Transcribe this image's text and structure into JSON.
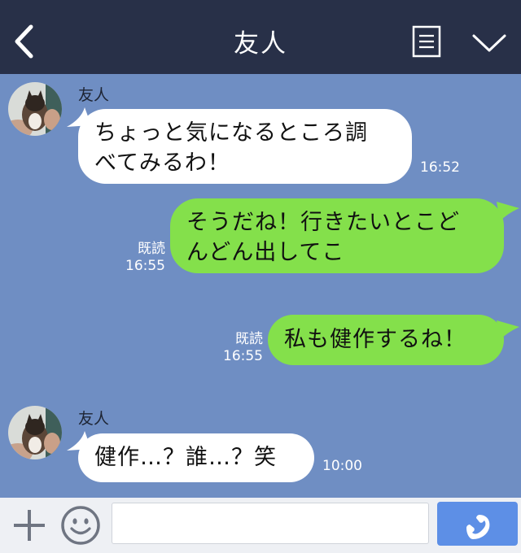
{
  "header": {
    "title": "友人",
    "icons": {
      "back": "chevron-left-icon",
      "memo": "note-icon",
      "menu": "chevron-down-icon"
    }
  },
  "messages": [
    {
      "side": "left",
      "sender": "友人",
      "lines": [
        "ちょっと気になるところ調",
        "べてみるわ！"
      ],
      "time": "16:52"
    },
    {
      "side": "right",
      "read": "既読",
      "lines": [
        "そうだね！行きたいとこど",
        "んどん出してこ"
      ],
      "time": "16:55"
    },
    {
      "side": "right",
      "read": "既読",
      "lines": [
        "私も健作するね！"
      ],
      "time": "16:55"
    },
    {
      "side": "left",
      "sender": "友人",
      "lines": [
        "健作…？誰…？笑"
      ],
      "time": "10:00"
    }
  ],
  "footer": {
    "input_value": "",
    "icons": {
      "plus": "plus-icon",
      "emoji": "smiley-icon",
      "call": "phone-icon"
    }
  },
  "colors": {
    "header_bg": "#283048",
    "chat_bg": "#6f8ec3",
    "outgoing_bubble": "#84e04b",
    "incoming_bubble": "#ffffff",
    "call_button": "#5d8fe6"
  }
}
